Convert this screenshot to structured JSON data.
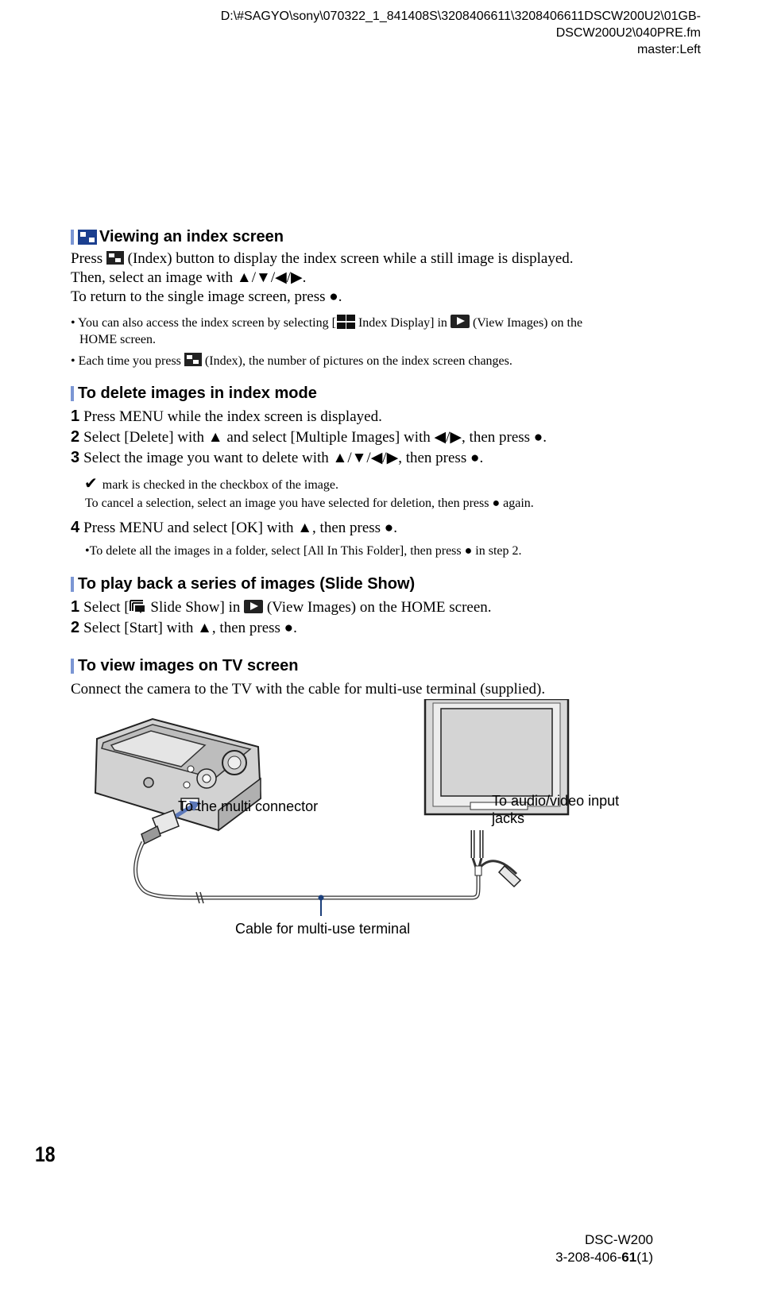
{
  "header": {
    "file_path_line1": "D:\\#SAGYO\\sony\\070322_1_841408S\\3208406611\\3208406611DSCW200U2\\01GB-",
    "file_path_line2": "DSCW200U2\\040PRE.fm",
    "master": "master:Left"
  },
  "sections": {
    "index_screen": {
      "title": "Viewing an index screen",
      "icon": "index-icon",
      "p1_a": "Press",
      "p1_b": "(Index) button to display the index screen while a still image is displayed.",
      "p2": "Then, select an image with ▲/▼/◀/▶.",
      "p3": "To return to the single image screen, press ●.",
      "note1_a": "• You can also access the index screen by selecting [",
      "note1_b": "Index Display] in",
      "note1_c": "(View Images) on the",
      "note1_d": "HOME screen.",
      "note2_a": "• Each time you press",
      "note2_b": "(Index), the number of pictures on the index screen changes."
    },
    "delete_images": {
      "title": "To delete images in index mode",
      "steps": [
        {
          "num": "1",
          "text": "Press MENU while the index screen is displayed."
        },
        {
          "num": "2",
          "text": "Select [Delete] with ▲ and select [Multiple Images] with ◀/▶, then press ●."
        },
        {
          "num": "3",
          "text": "Select the image you want to delete with ▲/▼/◀/▶, then press ●."
        },
        {
          "num": "4",
          "text": "Press MENU and select [OK] with ▲, then press ●."
        }
      ],
      "check_symbol": "✔",
      "step3_note1": "mark is checked in the checkbox of the image.",
      "step3_note2": "To cancel a selection, select an image you have selected for deletion, then press ● again.",
      "step4_note": "•To delete all the images in a folder, select [All In This Folder], then press ● in step 2."
    },
    "slide_show": {
      "title": "To play back a series of images (Slide Show)",
      "step1_num": "1",
      "step1_a": "Select [",
      "step1_b": "Slide Show] in",
      "step1_c": "(View Images) on the HOME screen.",
      "step2_num": "2",
      "step2": "Select [Start] with ▲, then press ●."
    },
    "tv_screen": {
      "title": "To view images on TV screen",
      "text": "Connect the camera to the TV with the cable for multi-use terminal (supplied).",
      "diagram": {
        "label_multi_connector": "To the multi connector",
        "label_av_line1": "To audio/video input",
        "label_av_line2": "jacks",
        "label_cable": "Cable for multi-use terminal"
      }
    }
  },
  "footer": {
    "page_number": "18",
    "model": "DSC-W200",
    "part_prefix": "3-208-406-",
    "part_bold": "61",
    "part_suffix": "(1)"
  },
  "colors": {
    "accent_bar": "#7b96d4",
    "title_icon": "#1b3f8f",
    "arrow": "#5b77b8",
    "cable_marker": "#1c3f7a"
  }
}
